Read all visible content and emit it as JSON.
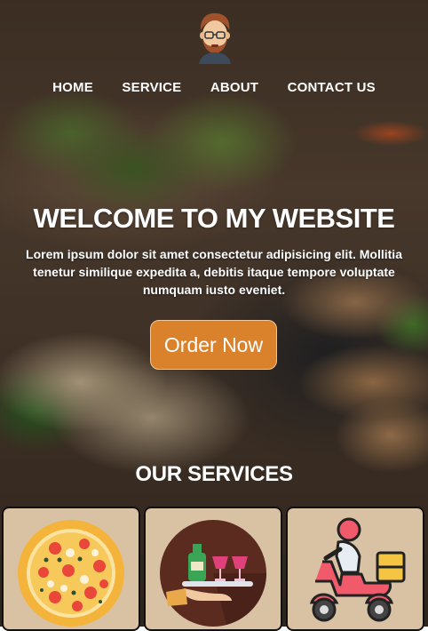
{
  "nav": {
    "items": [
      {
        "label": "HOME"
      },
      {
        "label": "SERVICE"
      },
      {
        "label": "ABOUT"
      },
      {
        "label": "CONTACT US"
      }
    ]
  },
  "hero": {
    "title": "WELCOME TO MY WEBSITE",
    "lead": "Lorem ipsum dolor sit amet consectetur adipisicing elit. Mollitia tenetur similique expedita a, debitis itaque tempore voluptate numquam iusto eveniet.",
    "cta_label": "Order Now"
  },
  "services": {
    "title": "OUR SERVICES",
    "cards": [
      {
        "icon": "pizza-icon"
      },
      {
        "icon": "serving-tray-icon"
      },
      {
        "icon": "delivery-scooter-icon"
      }
    ]
  },
  "colors": {
    "cta": "#d9822b",
    "card_bg": "#d9c2a3"
  }
}
